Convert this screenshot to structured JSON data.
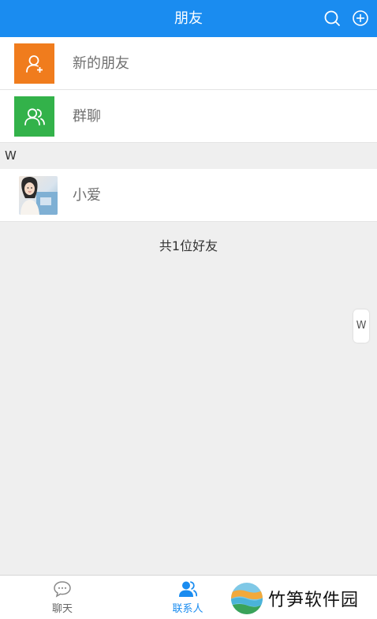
{
  "header": {
    "title": "朋友",
    "background": "#1a8cf0",
    "icons": [
      "search-icon",
      "add-circle-icon"
    ]
  },
  "entries": [
    {
      "label": "新的朋友",
      "icon": "add-user-icon",
      "color": "#f07c1d"
    },
    {
      "label": "群聊",
      "icon": "group-icon",
      "color": "#33b24a"
    }
  ],
  "sections": [
    {
      "letter": "W",
      "contacts": [
        {
          "name": "小爱",
          "icon": "avatar-photo"
        }
      ]
    }
  ],
  "friend_count_text": "共1位好友",
  "index_bar": [
    "W"
  ],
  "tabs": [
    {
      "label": "聊天",
      "icon": "chat-bubble-icon",
      "active": false
    },
    {
      "label": "联系人",
      "icon": "contacts-icon",
      "active": true
    }
  ],
  "watermark": {
    "text": "竹笋软件园"
  },
  "colors": {
    "accent": "#1a8cf0",
    "background": "#efefef"
  }
}
